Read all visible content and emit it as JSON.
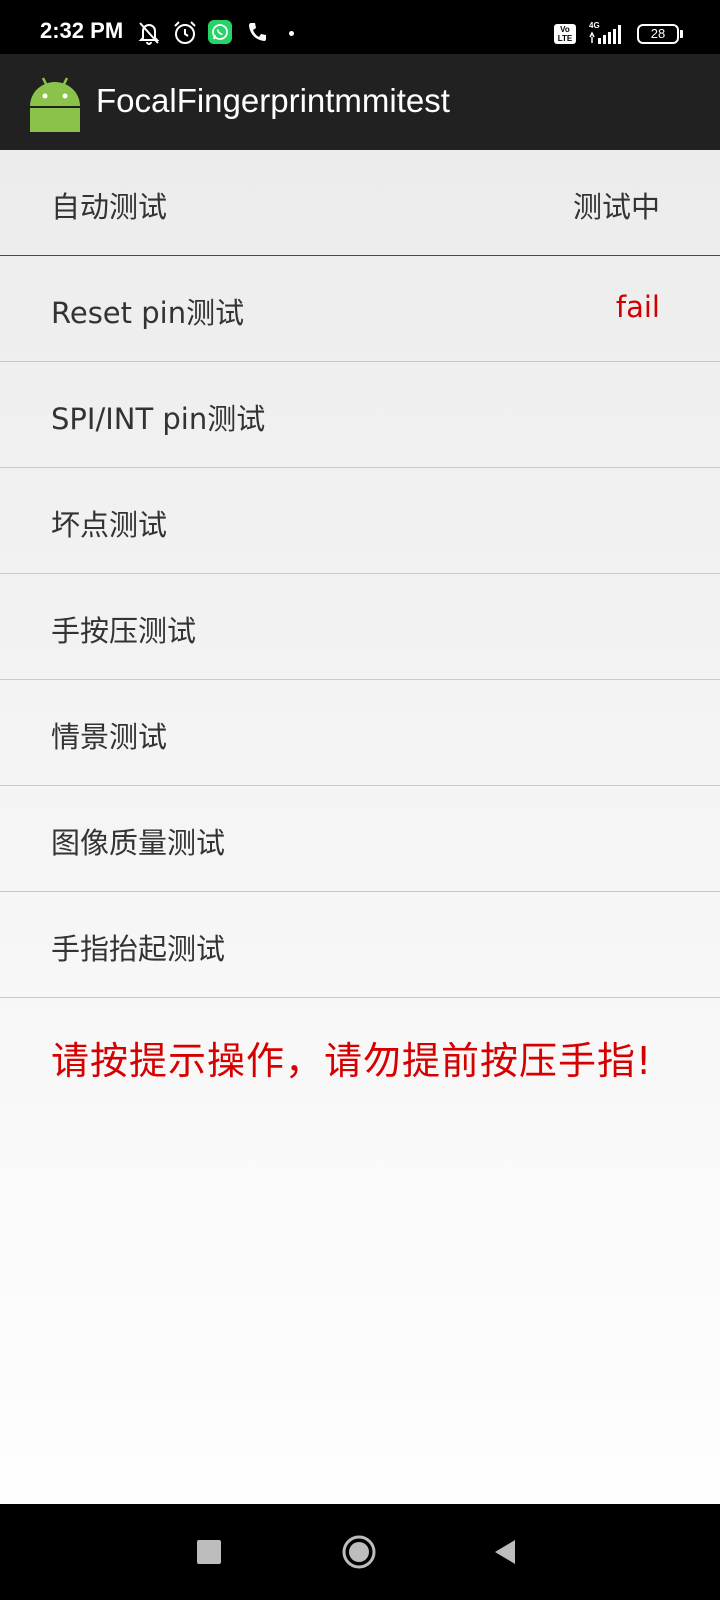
{
  "status_bar": {
    "time": "2:32 PM",
    "icons": [
      "bell-off-icon",
      "alarm-icon",
      "whatsapp-icon",
      "phone-icon",
      "dot-icon",
      "volte-icon",
      "signal-icon",
      "battery-icon"
    ],
    "volte_line1": "Vo",
    "volte_line2": "LTE",
    "network_type": "4G",
    "battery_level": "28"
  },
  "app_bar": {
    "title": "FocalFingerprintmmitest",
    "logo": "android-robot-icon"
  },
  "test_list": {
    "header": {
      "label": "自动测试",
      "status": "测试中"
    },
    "items": [
      {
        "label": "Reset pin测试",
        "status": "fail"
      },
      {
        "label": "SPI/INT pin测试",
        "status": ""
      },
      {
        "label": "坏点测试",
        "status": ""
      },
      {
        "label": "手按压测试",
        "status": ""
      },
      {
        "label": "情景测试",
        "status": ""
      },
      {
        "label": "图像质量测试",
        "status": ""
      },
      {
        "label": "手指抬起测试",
        "status": ""
      }
    ]
  },
  "hint": "请按提示操作，请勿提前按压手指!",
  "nav_bar": {
    "buttons": [
      "recents-button",
      "home-button",
      "back-button"
    ]
  },
  "colors": {
    "app_bar": "#212121",
    "fail": "#d00000",
    "hint": "#d60000",
    "android_green": "#8bc34a"
  }
}
